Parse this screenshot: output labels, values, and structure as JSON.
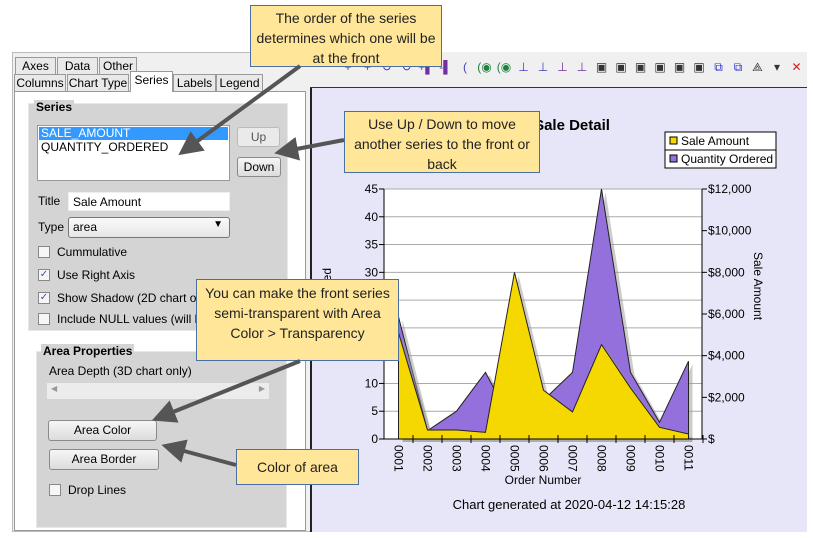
{
  "tabs_row1": [
    {
      "label": "Axes"
    },
    {
      "label": "Data"
    },
    {
      "label": "Other"
    }
  ],
  "tabs_row2": [
    {
      "label": "Columns"
    },
    {
      "label": "Chart Type"
    },
    {
      "label": "Series",
      "active": true
    },
    {
      "label": "Labels"
    },
    {
      "label": "Legend"
    }
  ],
  "series_group": {
    "label": "Series",
    "list": [
      "SALE_AMOUNT",
      "QUANTITY_ORDERED"
    ],
    "selected": "SALE_AMOUNT",
    "up_label": "Up",
    "down_label": "Down",
    "title_label": "Title",
    "title_value": "Sale Amount",
    "type_label": "Type",
    "type_value": "area",
    "checkboxes": [
      {
        "label": "Cummulative",
        "checked": false
      },
      {
        "label": "Use Right Axis",
        "checked": true
      },
      {
        "label": "Show Shadow (2D chart only)",
        "checked": true
      },
      {
        "label": "Include NULL values (will be c",
        "checked": false
      }
    ]
  },
  "area_group": {
    "label": "Area Properties",
    "depth_label": "Area Depth (3D chart only)",
    "area_color_label": "Area Color",
    "area_border_label": "Area Border",
    "drop_lines_label": "Drop Lines",
    "drop_lines_checked": false
  },
  "toolbar_icons": [
    "add-series-icon",
    "add-series-icon",
    "undo-icon",
    "redo-icon",
    "add-bar-icon",
    "remove-bar-icon",
    "rotate-left-icon",
    "view-icon",
    "view-icon",
    "axis-left-icon",
    "axis-right-icon",
    "axis-up-icon",
    "axis-down-icon",
    "add-depth-icon",
    "remove-depth-icon",
    "add-depth-icon",
    "remove-depth-icon",
    "add-depth-icon",
    "remove-depth-icon",
    "3d-box-icon",
    "overlap-icon",
    "axes-3d-icon",
    "dropdown-icon",
    "clear-icon"
  ],
  "callouts": [
    "The order of the series determines which one will be at the front",
    "Use Up / Down to move another series to the front or back",
    "You can make the front series semi-transparent with Area Color > Transparency",
    "Color of area"
  ],
  "chart_data": {
    "type": "area",
    "title": "Sale Detail",
    "xlabel": "Order Number",
    "ylabel_left": "Quantity Ordered",
    "ylabel_right": "Sale Amount",
    "footer": "Chart generated at 2020-04-12 14:15:28",
    "categories": [
      "0001",
      "0002",
      "0003",
      "0004",
      "0005",
      "0006",
      "0007",
      "0008",
      "0009",
      "0010",
      "0011"
    ],
    "left_axis": {
      "range": [
        0,
        45
      ],
      "ticks": [
        "0",
        "5",
        "10",
        "15",
        "20",
        "25",
        "30",
        "35",
        "40",
        "45"
      ]
    },
    "right_axis": {
      "range": [
        0,
        12000
      ],
      "ticks": [
        "$",
        "$2,000",
        "$4,000",
        "$6,000",
        "$8,000",
        "$10,000",
        "$12,000"
      ]
    },
    "grid": true,
    "legend_placement": "top-right",
    "series": [
      {
        "name": "Sale Amount",
        "axis": "right",
        "color": "#f5d800",
        "values": [
          5100,
          430,
          430,
          320,
          8000,
          2340,
          1300,
          4530,
          2450,
          560,
          240
        ]
      },
      {
        "name": "Quantity Ordered",
        "axis": "left",
        "color": "#9370db",
        "values": [
          22,
          1.5,
          5,
          12,
          2,
          7,
          12,
          45,
          12,
          3,
          14
        ]
      }
    ]
  }
}
